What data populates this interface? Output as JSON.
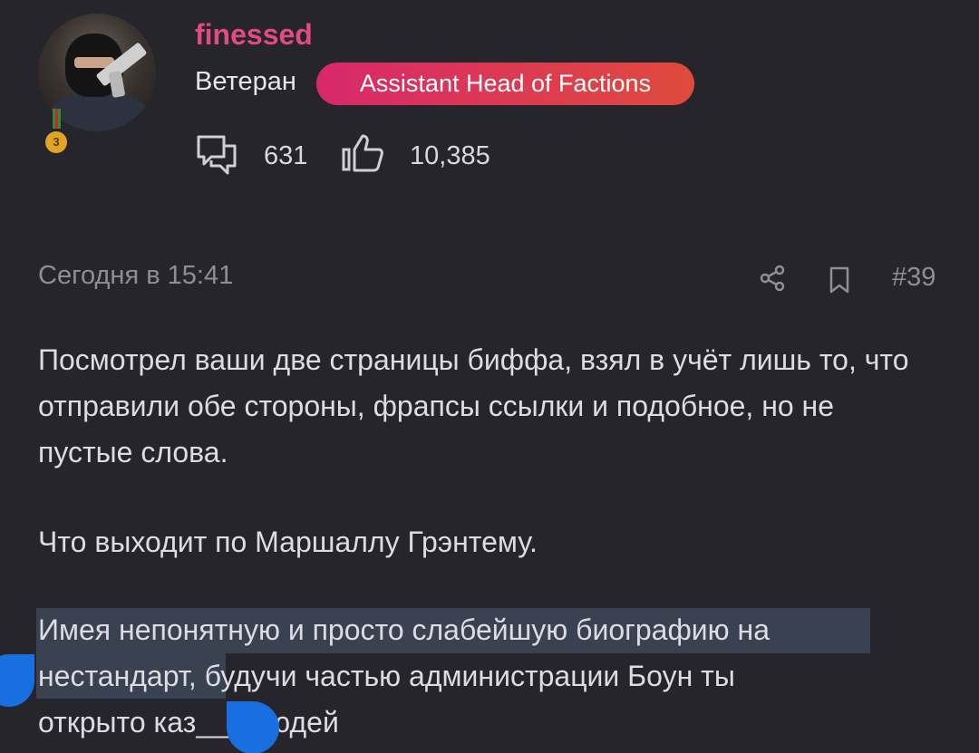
{
  "user": {
    "name": "finessed",
    "rank": "Ветеран",
    "role": "Assistant Head of Factions",
    "medal_level": "3",
    "messages": "631",
    "reactions": "10,385"
  },
  "post": {
    "time": "Сегодня в 15:41",
    "number": "#39",
    "paragraph1": "Посмотрел ваши две страницы биффа, взял в учёт лишь то, что отправили обе стороны, фрапсы ссылки и подобное, но не пустые слова.",
    "paragraph2": "Что выходит по Маршаллу Грэнтему.",
    "p3_line1": "Имея непонятную и просто слабейшую биографию на",
    "p3_line2_selected": "нестандарт,",
    "p3_line2_rest": " будучи частью администрации Боун ты",
    "p3_line3": "открыто каз__ь людей"
  },
  "icons": [
    "messages-icon",
    "like-icon",
    "share-icon",
    "bookmark-icon"
  ],
  "colors": {
    "background": "#25252b",
    "username": "#e24a86",
    "badge_start": "#d8286a",
    "badge_end": "#e04a3c",
    "selection": "#3a4150",
    "selection_handle": "#1a6fe0"
  }
}
